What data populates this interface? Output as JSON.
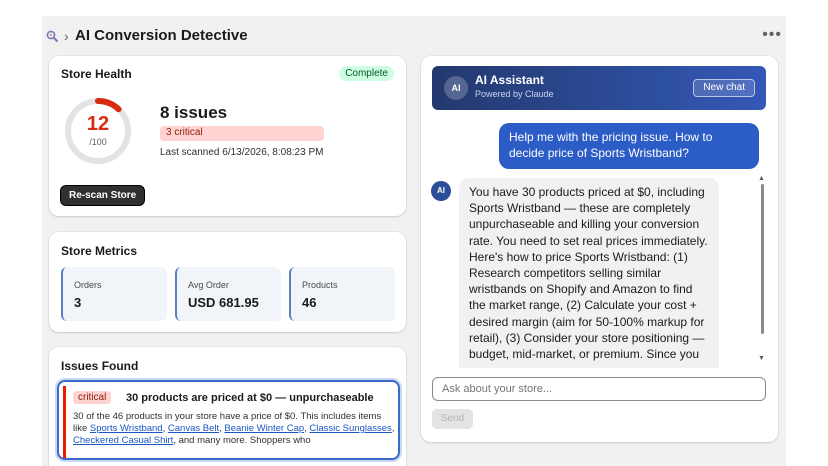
{
  "header": {
    "title": "AI Conversion Detective",
    "breadcrumb_separator": "›",
    "more_label": "•••"
  },
  "health": {
    "title": "Store Health",
    "status": "Complete",
    "score": "12",
    "score_denominator": "/100",
    "score_fraction": 0.12,
    "issues_count": "8 issues",
    "critical": "3 critical",
    "last_scanned": "Last scanned 6/13/2026, 8:08:23 PM",
    "rescan_label": "Re-scan Store",
    "colors": {
      "score": "#d72c0d",
      "ring_bg": "#e3e3e3"
    }
  },
  "metrics": {
    "title": "Store Metrics",
    "items": [
      {
        "label": "Orders",
        "value": "3"
      },
      {
        "label": "Avg Order",
        "value": "USD 681.95"
      },
      {
        "label": "Products",
        "value": "46"
      }
    ]
  },
  "issues": {
    "title": "Issues Found",
    "items": [
      {
        "severity": "critical",
        "title": "30 products are priced at $0 — unpurchaseable",
        "desc_intro": "30 of the 46 products in your store have a price of $0. This includes items like ",
        "links": [
          "Sports Wristband",
          "Canvas Belt",
          "Beanie Winter Cap",
          "Classic Sunglasses",
          "Checkered Casual Shirt"
        ],
        "desc_outro": ", and many more. Shoppers who"
      }
    ]
  },
  "assistant": {
    "avatar": "AI",
    "title": "AI Assistant",
    "subtitle": "Powered by Claude",
    "new_chat_label": "New chat",
    "messages": [
      {
        "role": "user",
        "text": "Help me with the pricing issue. How to decide price of Sports Wristband?"
      },
      {
        "role": "assistant",
        "avatar": "AI",
        "text": "You have 30 products priced at $0, including Sports Wristband — these are completely unpurchaseable and killing your conversion rate. You need to set real prices immediately. Here's how to price Sports Wristband: (1) Research competitors selling similar wristbands on Shopify and Amazon to find the market range, (2) Calculate your cost + desired margin (aim for 50-100% markup for retail), (3) Consider your store positioning — budget, mid-market, or premium. Since you"
      }
    ],
    "input_placeholder": "Ask about your store...",
    "send_label": "Send"
  }
}
